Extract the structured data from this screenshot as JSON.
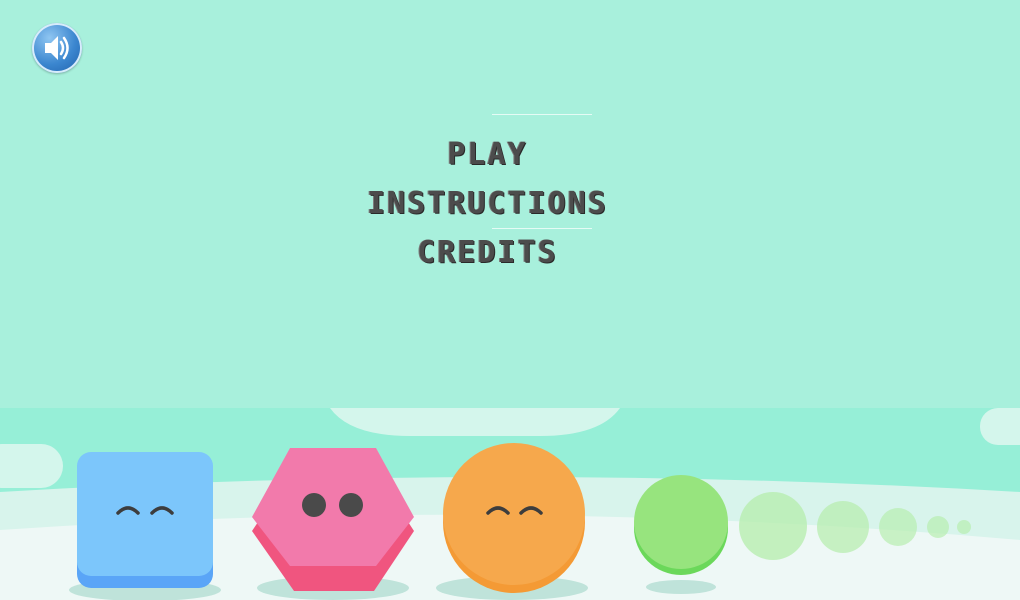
{
  "sound_button": {
    "icon": "speaker-icon",
    "state": "on"
  },
  "menu": {
    "play_label": "PLAY",
    "instructions_label": "INSTRUCTIONS",
    "credits_label": "CREDITS"
  },
  "characters": [
    {
      "shape": "square",
      "color": "#7cc6fb",
      "eyes": "closed"
    },
    {
      "shape": "hexagon",
      "color": "#f27aab",
      "eyes": "open"
    },
    {
      "shape": "circle",
      "color": "#f6a84c",
      "eyes": "closed"
    },
    {
      "shape": "circle",
      "color": "#97e47e",
      "eyes": "none"
    }
  ],
  "colors": {
    "background": "#a8f0dc",
    "ground": "#eef8f6",
    "menu_text": "#4c4c4c",
    "sound_button": "#3b86cf"
  }
}
